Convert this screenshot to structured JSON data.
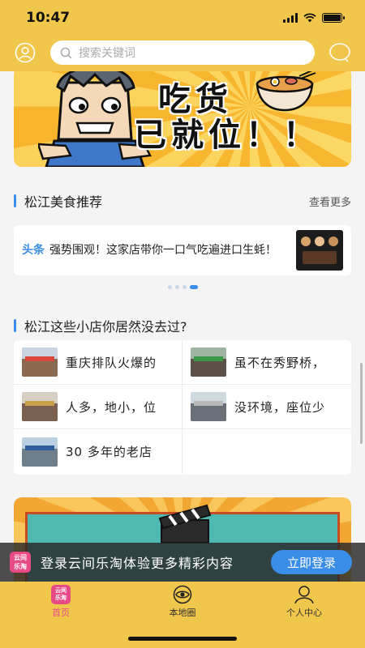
{
  "status_bar": {
    "time": "10:47"
  },
  "search": {
    "placeholder": "搜索关键词"
  },
  "banner_top": {
    "line1": "吃货",
    "line2": "已就位！！"
  },
  "food_section": {
    "title": "松江美食推荐",
    "more": "查看更多"
  },
  "news": {
    "tag": "头条",
    "text": "强势围观！这家店带你一口气吃遍进口生蚝！"
  },
  "carousel": {
    "total": 4,
    "active": 4
  },
  "shops_section": {
    "title": "松江这些小店你居然没去过?",
    "items": [
      {
        "name": "重庆排队火爆的"
      },
      {
        "name": "虽不在秀野桥，"
      },
      {
        "name": "人多，地小，位"
      },
      {
        "name": "没环境，座位少"
      },
      {
        "name": "30 多年的老店"
      }
    ]
  },
  "login_bar": {
    "logo_line1": "云间",
    "logo_line2": "乐淘",
    "text": "登录云间乐淘体验更多精彩内容",
    "button": "立即登录"
  },
  "tab_bar": {
    "tabs": [
      {
        "label": "首页",
        "icon": "app-logo-icon",
        "active": true
      },
      {
        "label": "本地圈",
        "icon": "eye-circle-icon",
        "active": false
      },
      {
        "label": "个人中心",
        "icon": "person-icon",
        "active": false
      }
    ],
    "logo_line1": "云间",
    "logo_line2": "乐淘"
  },
  "colors": {
    "header": "#f0c64b",
    "accent": "#3b8ee8",
    "brand": "#e84a86"
  }
}
